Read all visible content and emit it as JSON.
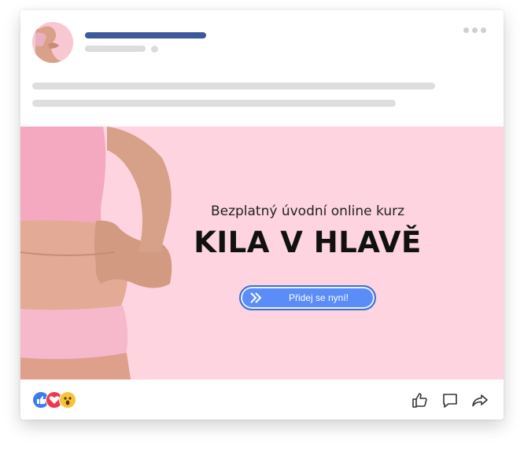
{
  "post": {
    "ad": {
      "subtitle": "Bezplatný úvodní online kurz",
      "title": "KILA V HLAVĚ",
      "cta_label": "Přidej se nyní!"
    },
    "reactions": [
      {
        "icon": "like-reaction-icon",
        "color": "#3b7bef"
      },
      {
        "icon": "love-reaction-icon",
        "color": "#f0364f"
      },
      {
        "icon": "wow-reaction-icon",
        "color": "#f7c33b"
      }
    ],
    "actions": [
      {
        "icon": "like-icon"
      },
      {
        "icon": "comment-icon"
      },
      {
        "icon": "share-icon"
      }
    ],
    "colors": {
      "name_bar": "#3b5a9a",
      "placeholder": "#dcdcdc",
      "banner_bg": "#fdd4df",
      "cta": "#5a8df7"
    }
  }
}
